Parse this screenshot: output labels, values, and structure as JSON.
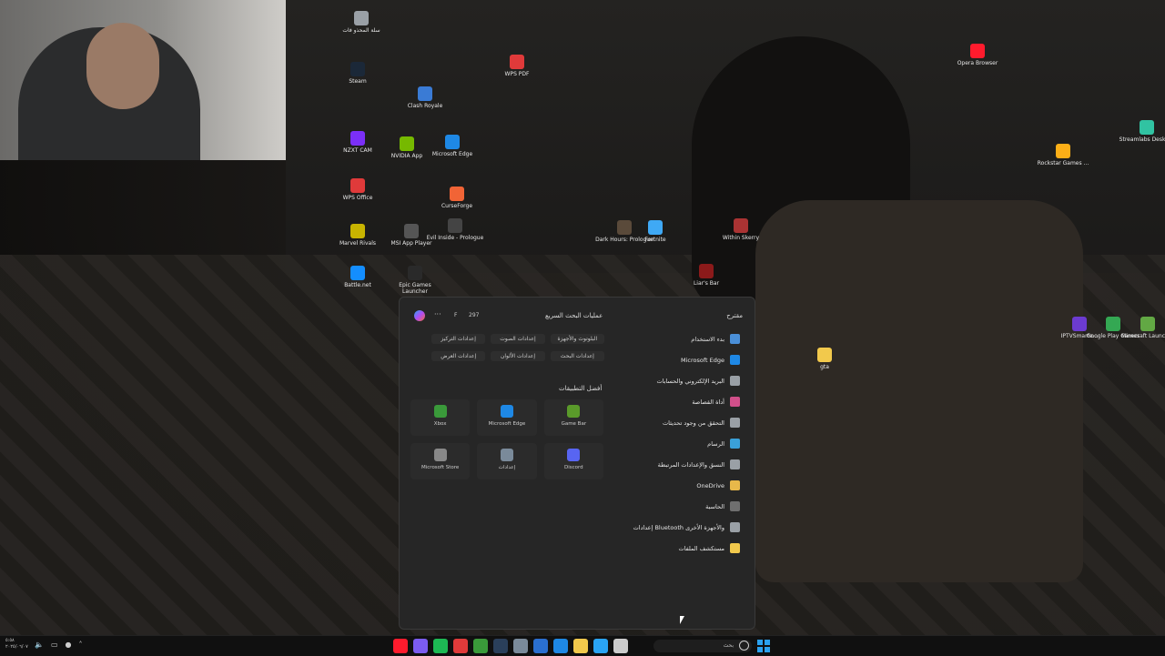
{
  "desktop": {
    "icons": [
      {
        "label": "سلة المحذو فات",
        "color": "#9aa0a6"
      },
      {
        "label": "Steam",
        "color": "#1b2838"
      },
      {
        "label": "WPS PDF",
        "color": "#e03a3a"
      },
      {
        "label": "Clash Royale",
        "color": "#3a7bd5"
      },
      {
        "label": "NZXT CAM",
        "color": "#7b2ff7"
      },
      {
        "label": "NVIDIA App",
        "color": "#76b900"
      },
      {
        "label": "Microsoft Edge",
        "color": "#1e88e5"
      },
      {
        "label": "WPS Office",
        "color": "#e03a3a"
      },
      {
        "label": "CurseForge",
        "color": "#f16436"
      },
      {
        "label": "Marvel Rivals",
        "color": "#c8b400"
      },
      {
        "label": "MSI App Player",
        "color": "#555555"
      },
      {
        "label": "Evil Inside - Prologue",
        "color": "#444444"
      },
      {
        "label": "Dark Hours: Prologue",
        "color": "#5a4a3a"
      },
      {
        "label": "Fortnite",
        "color": "#3fa9f5"
      },
      {
        "label": "Within Skerry",
        "color": "#a33"
      },
      {
        "label": "Battle.net",
        "color": "#148eff"
      },
      {
        "label": "Epic Games Launcher",
        "color": "#2a2a2a"
      },
      {
        "label": "Liar's Bar",
        "color": "#8b1a1a"
      },
      {
        "label": "Opera Browser",
        "color": "#ff1b2d"
      },
      {
        "label": "Streamlabs Desktop",
        "color": "#31c3a2"
      },
      {
        "label": "Rockstar Games ...",
        "color": "#fcaf17"
      },
      {
        "label": "gta",
        "color": "#f2c94c"
      },
      {
        "label": "IPTVSmarte...",
        "color": "#6c3bd1"
      },
      {
        "label": "Google Play Games",
        "color": "#34a853"
      },
      {
        "label": "Minecraft Launcher",
        "color": "#62a844"
      }
    ]
  },
  "start_menu": {
    "right_title": "مقترح",
    "left_title": "عمليات البحث السريع",
    "badge_count": "297",
    "f_label": "F",
    "more_label": "···",
    "suggested": [
      {
        "label": "بدء الاستخدام",
        "icon": "get-started-icon",
        "color": "#4a8fd8"
      },
      {
        "label": "Microsoft Edge",
        "icon": "edge-icon",
        "color": "#1e88e5"
      },
      {
        "label": "البريد الإلكتروني والحسابات",
        "icon": "mail-icon",
        "color": "#9aa0a6"
      },
      {
        "label": "أداة القصاصة",
        "icon": "snipping-tool-icon",
        "color": "#d14f8a"
      },
      {
        "label": "التحقق من وجود تحديثات",
        "icon": "refresh-icon",
        "color": "#9aa0a6"
      },
      {
        "label": "الرسام",
        "icon": "paint-icon",
        "color": "#3aa0d8"
      },
      {
        "label": "النسق والإعدادات المرتبطة",
        "icon": "pen-icon",
        "color": "#9aa0a6"
      },
      {
        "label": "OneDrive",
        "icon": "onedrive-icon",
        "color": "#e8b84a"
      },
      {
        "label": "الحاسبة",
        "icon": "calculator-icon",
        "color": "#6f6f6f"
      },
      {
        "label": "إعدادات Bluetooth والأجهزة الأخرى",
        "icon": "bluetooth-icon",
        "color": "#9aa0a6"
      },
      {
        "label": "مستكشف الملفات",
        "icon": "folder-icon",
        "color": "#f2c94c"
      }
    ],
    "quick_searches": [
      "إعدادات التركيز",
      "إعدادات الصوت",
      "البلوتوث والأجهزة",
      "إعدادات العرض",
      "إعدادات الألوان",
      "إعدادات البحث"
    ],
    "top_apps_title": "أفضل التطبيقات",
    "top_apps": [
      {
        "label": "Xbox",
        "icon": "xbox-icon",
        "color": "#3a9a3a"
      },
      {
        "label": "Microsoft Edge",
        "icon": "edge-icon",
        "color": "#1e88e5"
      },
      {
        "label": "Game Bar",
        "icon": "game-bar-icon",
        "color": "#5a9a2a"
      },
      {
        "label": "Microsoft Store",
        "icon": "store-icon",
        "color": "#888888"
      },
      {
        "label": "إعدادات",
        "icon": "settings-icon",
        "color": "#7a8a9a"
      },
      {
        "label": "Discord",
        "icon": "discord-icon",
        "color": "#5865f2"
      }
    ]
  },
  "taskbar": {
    "search_text": "بحث",
    "clock_time": "٥:٥٨",
    "clock_date": "٢٠٢٥/٠٦/٠٧",
    "icons": [
      {
        "name": "opera-taskbar-icon",
        "color": "#ff1b2d"
      },
      {
        "name": "app-taskbar-icon",
        "color": "#7b5cf0"
      },
      {
        "name": "spotify-taskbar-icon",
        "color": "#1db954"
      },
      {
        "name": "wps-taskbar-icon",
        "color": "#e03a3a"
      },
      {
        "name": "xbox-taskbar-icon",
        "color": "#3a9a3a"
      },
      {
        "name": "steam-taskbar-icon",
        "color": "#2a3f5a"
      },
      {
        "name": "settings-taskbar-icon",
        "color": "#7a8a9a"
      },
      {
        "name": "mail-taskbar-icon",
        "color": "#2a6fd0"
      },
      {
        "name": "edge-taskbar-icon",
        "color": "#1e88e5"
      },
      {
        "name": "explorer-taskbar-icon",
        "color": "#f2c94c"
      },
      {
        "name": "copilot-taskbar-icon",
        "color": "#2aa4f4"
      },
      {
        "name": "task-view-icon",
        "color": "#cccccc"
      }
    ]
  }
}
